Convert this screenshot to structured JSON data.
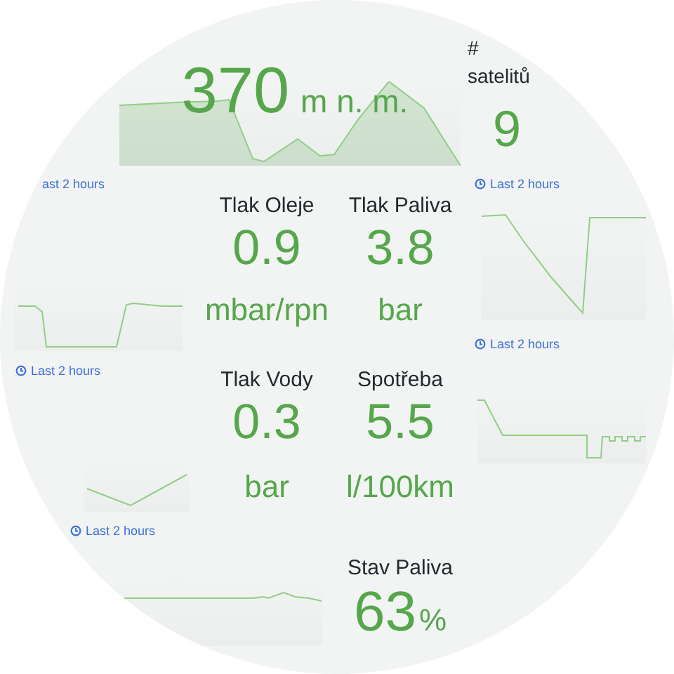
{
  "altitude": {
    "value": "370",
    "unit": "m n. m."
  },
  "satellites": {
    "label": "# satelitů",
    "value": "9"
  },
  "time_labels": [
    "ast 2 hours",
    "Last 2 hours",
    "Last 2 hours",
    "Last 2 hours",
    "Last 2 hours"
  ],
  "stats": [
    {
      "label": "Tlak Oleje",
      "value": "0.9",
      "unit": "mbar/rpn"
    },
    {
      "label": "Tlak Paliva",
      "value": "3.8",
      "unit": "bar"
    },
    {
      "label": "Tlak Vody",
      "value": "0.3",
      "unit": "bar"
    },
    {
      "label": "Spotřeba",
      "value": "5.5",
      "unit": "l/100km"
    }
  ],
  "fuel": {
    "label": "Stav Paliva",
    "value": "63",
    "unit": "%"
  }
}
